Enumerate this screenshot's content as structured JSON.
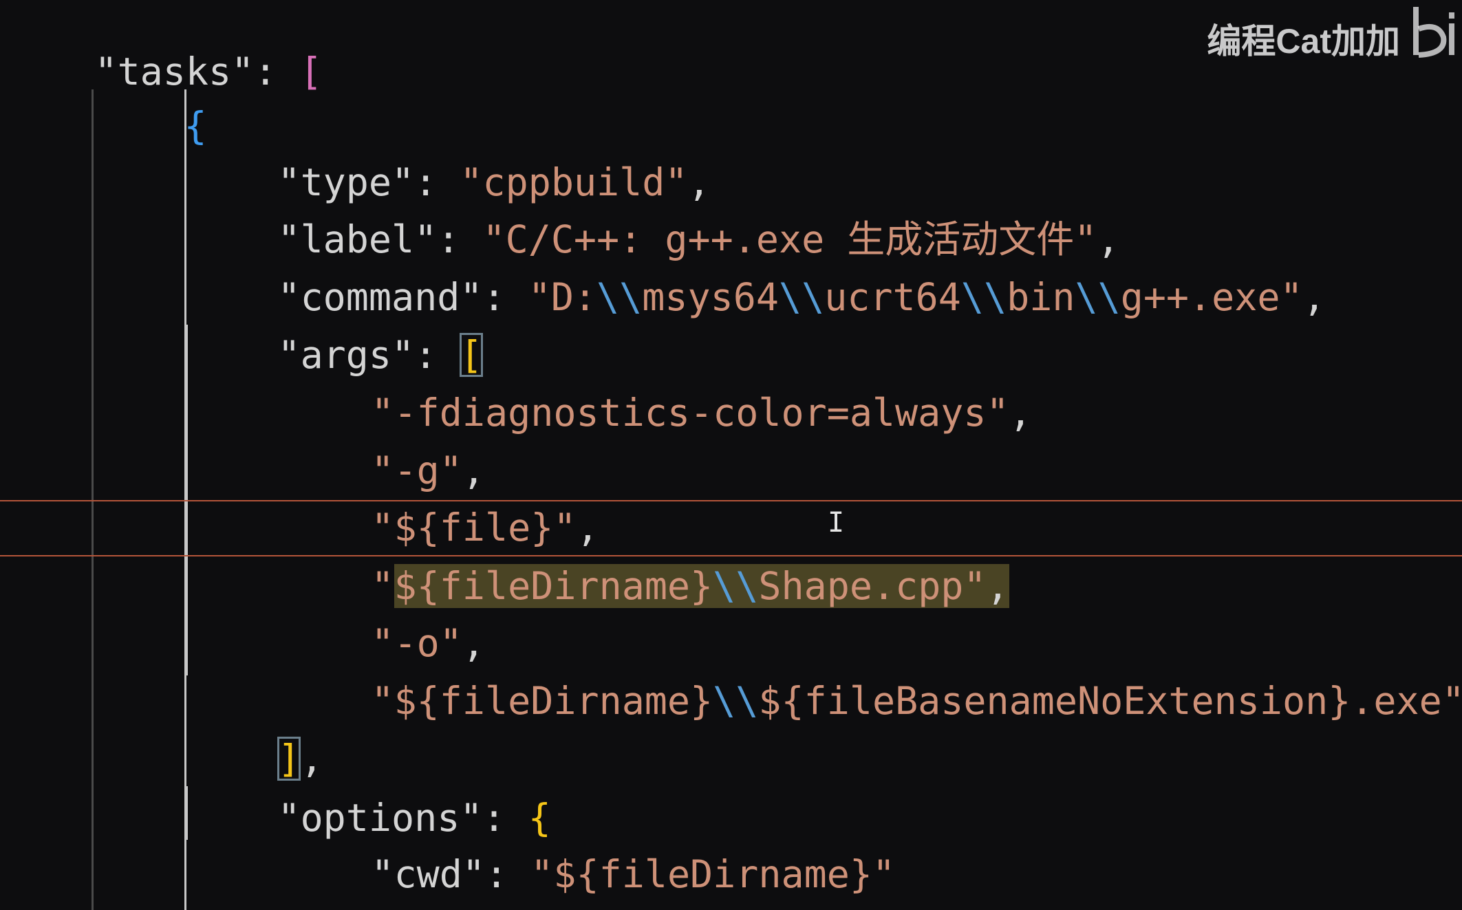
{
  "editor": {
    "lines": {
      "tasks_key": "\"tasks\"",
      "tasks_colon": ": ",
      "tasks_bracket": "[",
      "open_brace": "{",
      "type_key": "\"type\"",
      "type_value": "\"cppbuild\"",
      "label_key": "\"label\"",
      "label_value": "\"C/C++: g++.exe 生成活动文件\"",
      "command_key": "\"command\"",
      "command_part1": "\"D:",
      "command_esc1": "\\\\",
      "command_part2": "msys64",
      "command_esc2": "\\\\",
      "command_part3": "ucrt64",
      "command_esc3": "\\\\",
      "command_part4": "bin",
      "command_esc4": "\\\\",
      "command_part5": "g++.exe\"",
      "args_key": "\"args\"",
      "args_bracket": "[",
      "arg1": "\"-fdiagnostics-color=always\"",
      "arg2": "\"-g\"",
      "arg3": "\"${file}\"",
      "arg4_quote": "\"",
      "arg4_part1": "${fileDirname}",
      "arg4_esc": "\\\\",
      "arg4_part2": "Shape.cpp\"",
      "arg5": "\"-o\"",
      "arg6_part1": "\"${fileDirname}",
      "arg6_esc": "\\\\",
      "arg6_part2": "${fileBasenameNoExtension}.exe\"",
      "args_close": "]",
      "options_key": "\"options\"",
      "options_brace": "{",
      "cwd_key": "\"cwd\"",
      "cwd_value": "\"${fileDirname}\"",
      "options_close": "}"
    },
    "comma": ",",
    "colon": ": "
  },
  "watermark": {
    "text": "编程Cat加加"
  },
  "colors": {
    "background": "#0d0d0f",
    "string": "#ce9178",
    "escape": "#569cd6",
    "key": "#d4d4d4",
    "brace_blue": "#3f9cf0",
    "brace_gold": "#f5c518",
    "bracket_pink": "#d870b8",
    "highlight_border": "#b4553a",
    "selection": "#4a4424"
  }
}
